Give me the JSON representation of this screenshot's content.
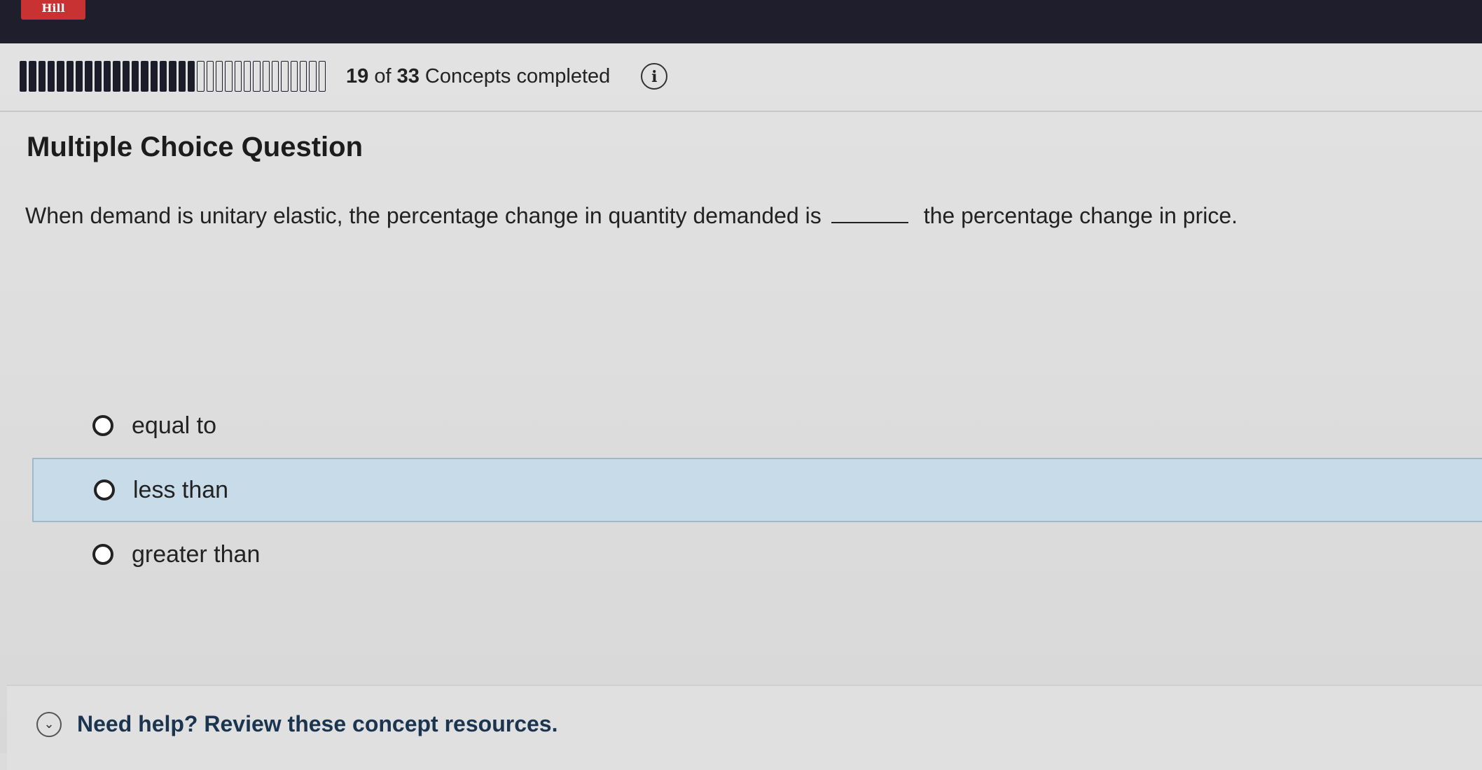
{
  "brand": {
    "logo_text": "Hill"
  },
  "progress": {
    "completed": 19,
    "total": 33,
    "completed_text": "19",
    "of_text": "of",
    "total_text": "33",
    "label": "Concepts completed"
  },
  "question": {
    "type_label": "Multiple Choice Question",
    "text_before": "When demand is unitary elastic, the percentage change in quantity demanded is",
    "text_after": "the percentage change in price."
  },
  "options": [
    {
      "label": "equal to",
      "selected": false
    },
    {
      "label": "less than",
      "selected": false,
      "highlighted": true
    },
    {
      "label": "greater than",
      "selected": false
    }
  ],
  "help": {
    "label": "Need help? Review these concept resources."
  },
  "icons": {
    "info": "info-icon",
    "expand": "chevron-down-icon"
  },
  "colors": {
    "top_bar": "#1f1e2c",
    "highlight": "#c8dbe8",
    "help_text": "#1b3550"
  }
}
